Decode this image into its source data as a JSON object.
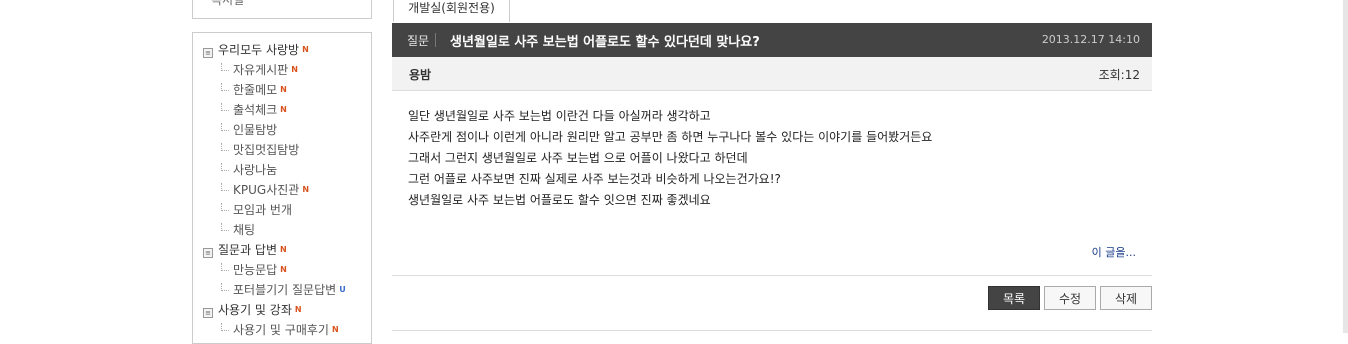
{
  "sidebar": {
    "top_item": "독서실",
    "menu": [
      {
        "type": "top",
        "label": "우리모두 사랑방",
        "badge": "N",
        "badge_type": "n"
      },
      {
        "type": "sub",
        "label": "자유게시판",
        "badge": "N",
        "badge_type": "n"
      },
      {
        "type": "sub",
        "label": "한줄메모",
        "badge": "N",
        "badge_type": "n"
      },
      {
        "type": "sub",
        "label": "출석체크",
        "badge": "N",
        "badge_type": "n"
      },
      {
        "type": "sub",
        "label": "인물탐방",
        "badge": "",
        "badge_type": ""
      },
      {
        "type": "sub",
        "label": "맛집멋집탐방",
        "badge": "",
        "badge_type": ""
      },
      {
        "type": "sub",
        "label": "사랑나눔",
        "badge": "",
        "badge_type": ""
      },
      {
        "type": "sub",
        "label": "KPUG사진관",
        "badge": "N",
        "badge_type": "n"
      },
      {
        "type": "sub",
        "label": "모임과 번개",
        "badge": "",
        "badge_type": ""
      },
      {
        "type": "sub",
        "label": "채팅",
        "badge": "",
        "badge_type": ""
      },
      {
        "type": "top",
        "label": "질문과 답변",
        "badge": "N",
        "badge_type": "n"
      },
      {
        "type": "sub",
        "label": "만능문답",
        "badge": "N",
        "badge_type": "n"
      },
      {
        "type": "sub",
        "label": "포터블기기 질문답변",
        "badge": "U",
        "badge_type": "u"
      },
      {
        "type": "top",
        "label": "사용기 및 강좌",
        "badge": "N",
        "badge_type": "n"
      },
      {
        "type": "sub",
        "label": "사용기 및 구매후기",
        "badge": "N",
        "badge_type": "n"
      }
    ]
  },
  "tab": {
    "label": "개발실(회원전용)"
  },
  "post": {
    "category": "질문",
    "title": "생년월일로 사주 보는법 어플로도 할수 있다던데 맞나요?",
    "date": "2013.12.17 14:10",
    "author": "용밤",
    "views": "조회:12",
    "body": [
      "일단 생년월일로 사주 보는법 이란건 다들 아실꺼라 생각하고",
      "사주란게 점이나 이런게 아니라 원리만 알고 공부만 좀 하면 누구나다 볼수 있다는 이야기를 들어봤거든요",
      "그래서 그런지 생년월일로 사주 보는법 으로 어플이 나왔다고 하던데",
      "그런 어플로 사주보면 진짜 실제로 사주 보는것과 비슷하게 나오는건가요!?",
      "생년월일로 사주 보는법 어플로도 할수 잇으면 진짜 좋겠네요"
    ],
    "more_link": "이 글을..."
  },
  "buttons": {
    "list": "목록",
    "edit": "수정",
    "delete": "삭제"
  },
  "colors": {
    "header_bg": "#444444",
    "badge_new": "#d9531e",
    "badge_updated": "#3a6ccc"
  }
}
